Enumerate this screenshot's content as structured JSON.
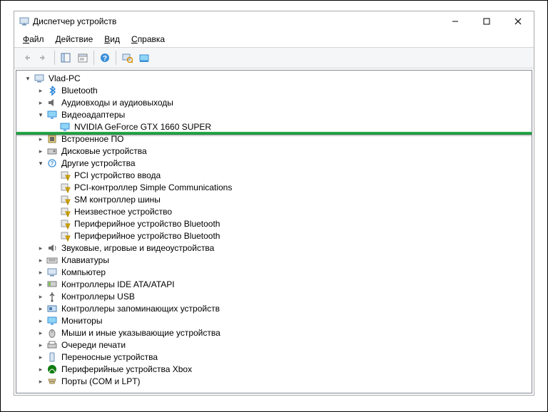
{
  "window": {
    "title": "Диспетчер устройств"
  },
  "menu": {
    "file": "Файл",
    "action": "Действие",
    "view": "Вид",
    "help": "Справка"
  },
  "tree": {
    "root": "Vlad-PC",
    "bluetooth": "Bluetooth",
    "audio": "Аудиовходы и аудиовыходы",
    "displayAdapters": "Видеоадаптеры",
    "nvidia": "NVIDIA GeForce GTX 1660 SUPER",
    "embedded": "Встроенное ПО",
    "disk": "Дисковые устройства",
    "otherDevices": "Другие устройства",
    "other_items": [
      "PCI устройство ввода",
      "PCI-контроллер Simple Communications",
      "SM контроллер шины",
      "Неизвестное устройство",
      "Периферийное устройство Bluetooth",
      "Периферийное устройство Bluetooth"
    ],
    "sound": "Звуковые, игровые и видеоустройства",
    "keyboards": "Клавиатуры",
    "computer": "Компьютер",
    "ide": "Контроллеры IDE ATA/ATAPI",
    "usb": "Контроллеры USB",
    "storageCtrl": "Контроллеры запоминающих устройств",
    "monitors": "Мониторы",
    "mice": "Мыши и иные указывающие устройства",
    "printQueues": "Очереди печати",
    "portable": "Переносные устройства",
    "xbox": "Периферийные устройства Xbox",
    "ports": "Порты (COM и LPT)"
  }
}
